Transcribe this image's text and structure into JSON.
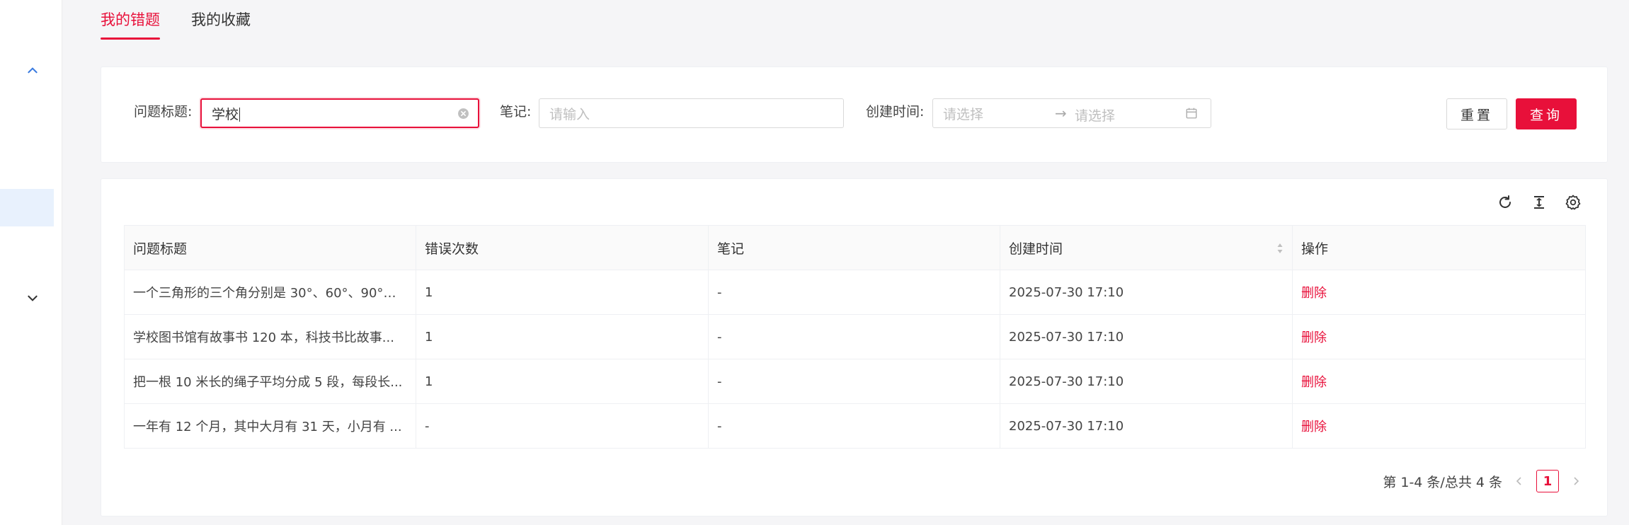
{
  "tabs": [
    {
      "label": "我的错题"
    },
    {
      "label": "我的收藏"
    }
  ],
  "filters": {
    "title_label": "问题标题:",
    "title_value": "学校",
    "note_label": "笔记:",
    "note_placeholder": "请输入",
    "created_label": "创建时间:",
    "date_start_placeholder": "请选择",
    "date_end_placeholder": "请选择",
    "date_separator": "→",
    "reset_label": "重置",
    "query_label": "查询"
  },
  "table": {
    "columns": [
      "问题标题",
      "错误次数",
      "笔记",
      "创建时间",
      "操作"
    ],
    "rows": [
      {
        "title": "一个三角形的三个角分别是 30°、60°、90°，...",
        "errors": "1",
        "note": "-",
        "created": "2025-07-30 17:10",
        "action": "删除"
      },
      {
        "title": "学校图书馆有故事书 120 本，科技书比故事...",
        "errors": "1",
        "note": "-",
        "created": "2025-07-30 17:10",
        "action": "删除"
      },
      {
        "title": "把一根 10 米长的绳子平均分成 5 段，每段长...",
        "errors": "1",
        "note": "-",
        "created": "2025-07-30 17:10",
        "action": "删除"
      },
      {
        "title": "一年有 12 个月，其中大月有 31 天，小月有 ...",
        "errors": "-",
        "note": "-",
        "created": "2025-07-30 17:10",
        "action": "删除"
      }
    ]
  },
  "pagination": {
    "summary": "第 1-4 条/总共 4 条",
    "current_page": "1"
  },
  "colors": {
    "accent": "#e8103a",
    "sidebar_active": "#e8f1fd",
    "link_blue": "#3a7be0"
  }
}
